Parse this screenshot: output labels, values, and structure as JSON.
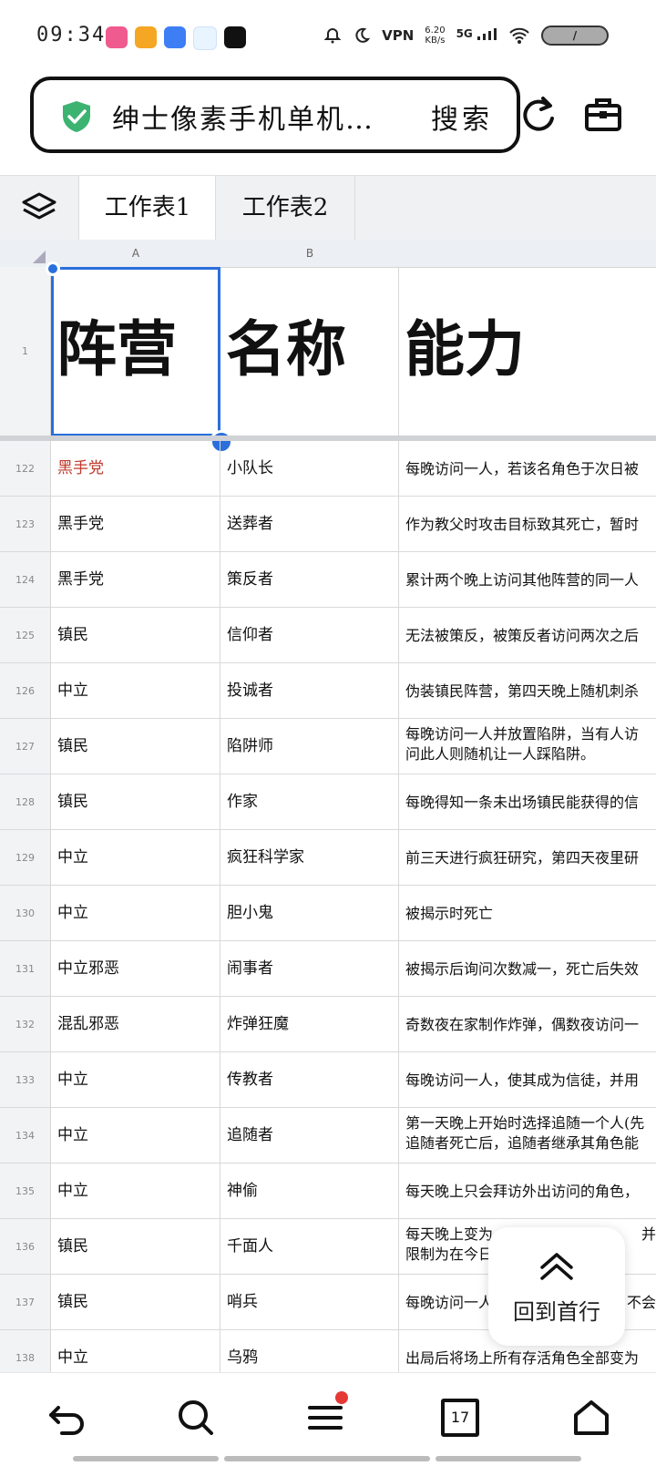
{
  "status_bar": {
    "time": "09:34",
    "speed_value": "6.20",
    "speed_unit": "KB/s",
    "network": "5G",
    "vpn": "VPN",
    "battery": "/",
    "app_colors": [
      "#ef5b8e",
      "#f5a623",
      "#3d7ef5",
      "#1aa3ff",
      "#111111"
    ]
  },
  "browser": {
    "address_text": "绅士像素手机单机…",
    "search_label": "搜索"
  },
  "sheet_tabs": [
    "工作表1",
    "工作表2"
  ],
  "columns": [
    "A",
    "B"
  ],
  "header_row": {
    "row_number": "1",
    "a": "阵营",
    "b": "名称",
    "c": "能力"
  },
  "rows": [
    {
      "num": "122",
      "a": "黑手党",
      "b": "小队长",
      "c": "每晚访问一人，若该名角色于次日被"
    },
    {
      "num": "123",
      "a": "黑手党",
      "b": "送葬者",
      "c": "作为教父时攻击目标致其死亡，暂时"
    },
    {
      "num": "124",
      "a": "黑手党",
      "b": "策反者",
      "c": "累计两个晚上访问其他阵营的同一人"
    },
    {
      "num": "125",
      "a": "镇民",
      "b": "信仰者",
      "c": "无法被策反，被策反者访问两次之后"
    },
    {
      "num": "126",
      "a": "中立",
      "b": "投诚者",
      "c": "伪装镇民阵营，第四天晚上随机刺杀"
    },
    {
      "num": "127",
      "a": "镇民",
      "b": "陷阱师",
      "c": "每晚访问一人并放置陷阱，当有人访",
      "c2": "问此人则随机让一人踩陷阱。"
    },
    {
      "num": "128",
      "a": "镇民",
      "b": "作家",
      "c": "每晚得知一条未出场镇民能获得的信"
    },
    {
      "num": "129",
      "a": "中立",
      "b": "疯狂科学家",
      "c": "前三天进行疯狂研究，第四天夜里研"
    },
    {
      "num": "130",
      "a": "中立",
      "b": "胆小鬼",
      "c": "被揭示时死亡"
    },
    {
      "num": "131",
      "a": "中立邪恶",
      "b": "闹事者",
      "c": "被揭示后询问次数减一，死亡后失效"
    },
    {
      "num": "132",
      "a": "混乱邪恶",
      "b": "炸弹狂魔",
      "c": "奇数夜在家制作炸弹，偶数夜访问一"
    },
    {
      "num": "133",
      "a": "中立",
      "b": "传教者",
      "c": "每晚访问一人，使其成为信徒，并用"
    },
    {
      "num": "134",
      "a": "中立",
      "b": "追随者",
      "c": "第一天晚上开始时选择追随一个人(先",
      "c2": "追随者死亡后，追随者继承其角色能"
    },
    {
      "num": "135",
      "a": "中立",
      "b": "神偷",
      "c": "每天晚上只会拜访外出访问的角色，"
    },
    {
      "num": "136",
      "a": "镇民",
      "b": "千面人",
      "c": "每天晚上变为",
      "c_tail": "并",
      "c2": "限制为在今日"
    },
    {
      "num": "137",
      "a": "镇民",
      "b": "哨兵",
      "c": "每晚访问一人",
      "c_tail": "不会"
    },
    {
      "num": "138",
      "a": "中立",
      "b": "乌鸦",
      "c": "出局后将场上所有存活角色全部变为"
    }
  ],
  "back_to_top": {
    "label": "回到首行"
  },
  "bottom_nav": {
    "page_count": "17"
  },
  "colors": {
    "selection": "#2a6fdb",
    "mafia_highlight": "#c0392b",
    "shield": "#3cb371"
  }
}
